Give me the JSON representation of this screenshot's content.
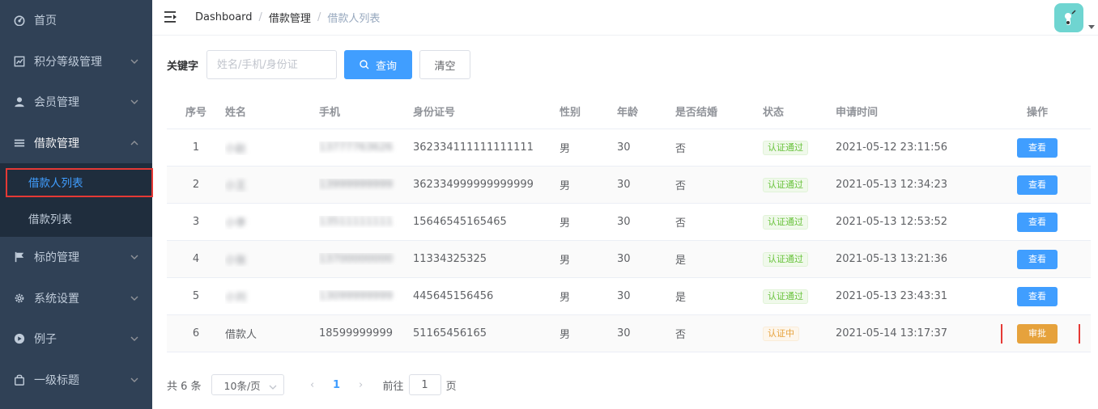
{
  "sidebar": {
    "items": [
      {
        "label": "首页",
        "icon": "dashboard-icon"
      },
      {
        "label": "积分等级管理",
        "icon": "chart-icon"
      },
      {
        "label": "会员管理",
        "icon": "user-icon"
      },
      {
        "label": "借款管理",
        "icon": "list-icon"
      },
      {
        "label": "标的管理",
        "icon": "flag-icon"
      },
      {
        "label": "系统设置",
        "icon": "gear-icon"
      },
      {
        "label": "例子",
        "icon": "example-icon"
      },
      {
        "label": "一级标题",
        "icon": "bag-icon"
      }
    ],
    "sub_items": [
      {
        "label": "借款人列表",
        "active": true
      },
      {
        "label": "借款列表",
        "active": false
      }
    ]
  },
  "breadcrumb": [
    "Dashboard",
    "借款管理",
    "借款人列表"
  ],
  "search": {
    "label": "关键字",
    "placeholder": "姓名/手机/身份证",
    "value": "",
    "query_label": "查询",
    "clear_label": "清空"
  },
  "table": {
    "headers": [
      "序号",
      "姓名",
      "手机",
      "身份证号",
      "性别",
      "年龄",
      "是否结婚",
      "状态",
      "申请时间",
      "操作"
    ],
    "rows": [
      {
        "no": "1",
        "name": "小赵",
        "phone": "13777763626",
        "id_card": "362334111111111111",
        "gender": "男",
        "age": "30",
        "married": "否",
        "status": "认证通过",
        "status_type": "ok",
        "time": "2021-05-12 23:11:56",
        "action": "查看"
      },
      {
        "no": "2",
        "name": "小王",
        "phone": "13999999999",
        "id_card": "362334999999999999",
        "gender": "男",
        "age": "30",
        "married": "否",
        "status": "认证通过",
        "status_type": "ok",
        "time": "2021-05-13 12:34:23",
        "action": "查看"
      },
      {
        "no": "3",
        "name": "小李",
        "phone": "13511111111",
        "id_card": "15646545165465",
        "gender": "男",
        "age": "30",
        "married": "否",
        "status": "认证通过",
        "status_type": "ok",
        "time": "2021-05-13 12:53:52",
        "action": "查看"
      },
      {
        "no": "4",
        "name": "小张",
        "phone": "13700000000",
        "id_card": "11334325325",
        "gender": "男",
        "age": "30",
        "married": "是",
        "status": "认证通过",
        "status_type": "ok",
        "time": "2021-05-13 13:21:36",
        "action": "查看"
      },
      {
        "no": "5",
        "name": "小刘",
        "phone": "13099999999",
        "id_card": "445645156456",
        "gender": "男",
        "age": "30",
        "married": "是",
        "status": "认证通过",
        "status_type": "ok",
        "time": "2021-05-13 23:43:31",
        "action": "查看"
      },
      {
        "no": "6",
        "name": "借款人",
        "phone": "18599999999",
        "id_card": "51165456165",
        "gender": "男",
        "age": "30",
        "married": "否",
        "status": "认证中",
        "status_type": "pending",
        "time": "2021-05-14 13:17:37",
        "action": "审批"
      }
    ]
  },
  "pagination": {
    "total": "共 6 条",
    "page_size": "10条/页",
    "current_page": "1",
    "goto_prefix": "前往",
    "goto_value": "1",
    "goto_suffix": "页"
  },
  "colors": {
    "sidebar_bg": "#304156",
    "submenu_bg": "#1f2d3d",
    "primary": "#409eff",
    "warning": "#e6a23c",
    "success": "#67c23a",
    "highlight": "#e53935"
  }
}
